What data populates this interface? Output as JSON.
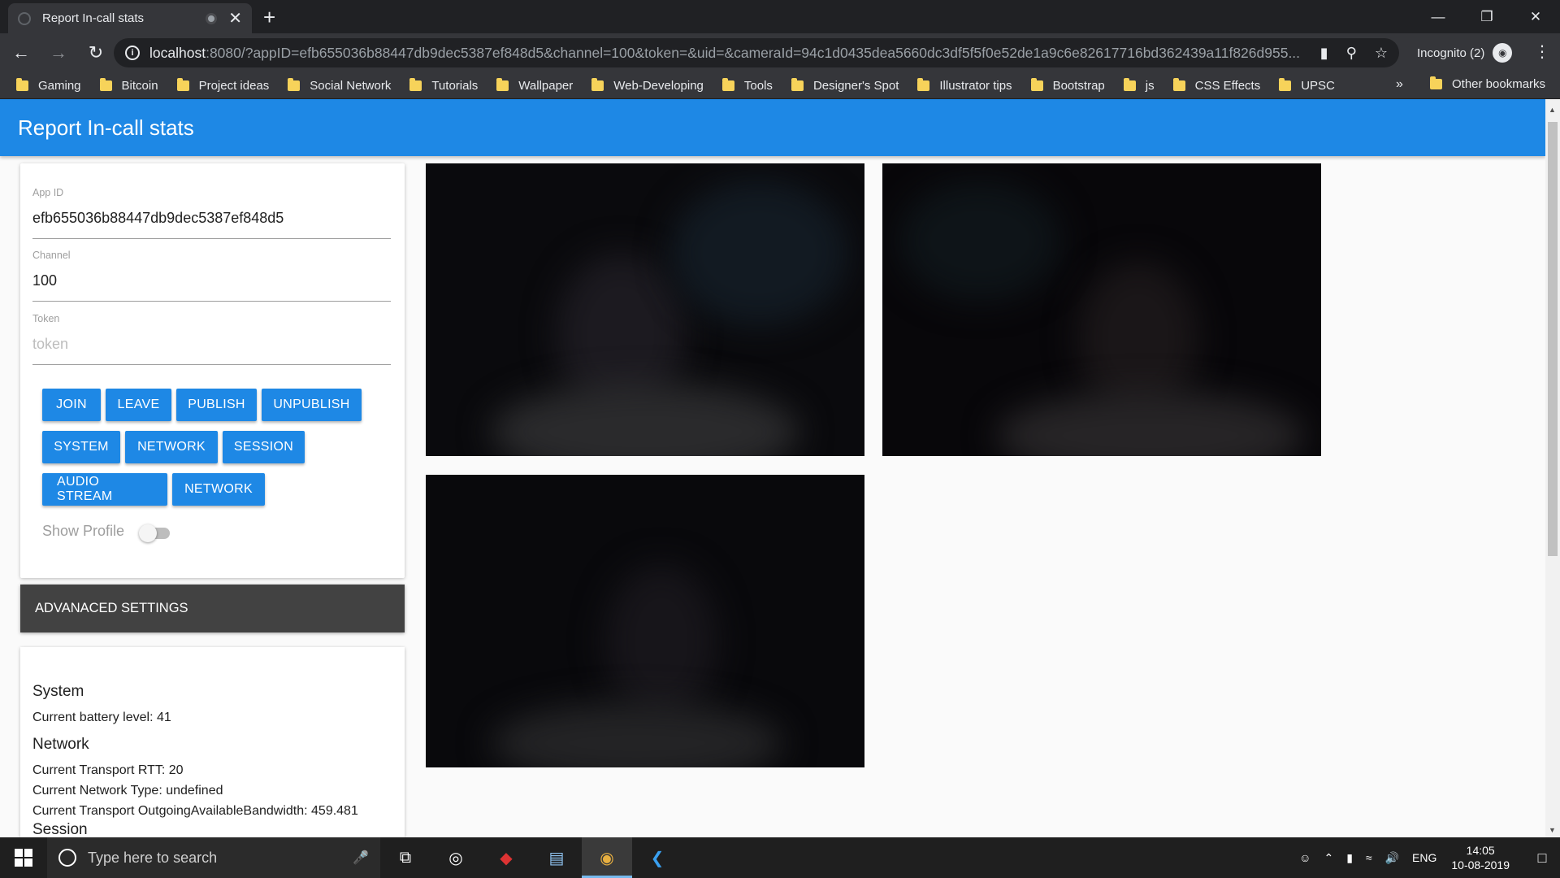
{
  "browser": {
    "tab_title": "Report In-call stats",
    "close_tab": "✕",
    "new_tab": "+",
    "url_host": "localhost",
    "url_rest": ":8080/?appID=efb655036b88447db9dec5387ef848d5&channel=100&token=&uid=&cameraId=94c1d0435dea5660dc3df5f5f0e52de1a9c6e82617716bd362439a11f826d955...",
    "incognito_label": "Incognito (2)",
    "bookmarks": [
      "Gaming",
      "Bitcoin",
      "Project ideas",
      "Social Network",
      "Tutorials",
      "Wallpaper",
      "Web-Developing",
      "Tools",
      "Designer's Spot",
      "Illustrator tips",
      "Bootstrap",
      "js",
      "CSS Effects",
      "UPSC"
    ],
    "bookmarks_more": "»",
    "other_bookmarks": "Other bookmarks"
  },
  "page": {
    "title": "Report In-call stats"
  },
  "form": {
    "app_id_label": "App ID",
    "app_id_value": "efb655036b88447db9dec5387ef848d5",
    "channel_label": "Channel",
    "channel_value": "100",
    "token_label": "Token",
    "token_placeholder": "token",
    "buttons_row1": [
      "JOIN",
      "LEAVE",
      "PUBLISH",
      "UNPUBLISH"
    ],
    "buttons_row2": [
      "SYSTEM",
      "NETWORK",
      "SESSION"
    ],
    "buttons_row3": [
      "AUDIO STREAM",
      "NETWORK"
    ],
    "show_profile_label": "Show Profile",
    "show_profile_on": false
  },
  "advanced": {
    "label": "ADVANACED SETTINGS"
  },
  "stats": {
    "system_heading": "System",
    "battery": "Current battery level: 41",
    "network_heading": "Network",
    "rtt": "Current Transport RTT: 20",
    "network_type": "Current Network Type: undefined",
    "bandwidth": "Current Transport OutgoingAvailableBandwidth: 459.481",
    "session_heading": "Session"
  },
  "taskbar": {
    "search_placeholder": "Type here to search",
    "language": "ENG",
    "time": "14:05",
    "date": "10-08-2019"
  },
  "colors": {
    "accent": "#1e88e5",
    "adv_bar": "#424242"
  }
}
